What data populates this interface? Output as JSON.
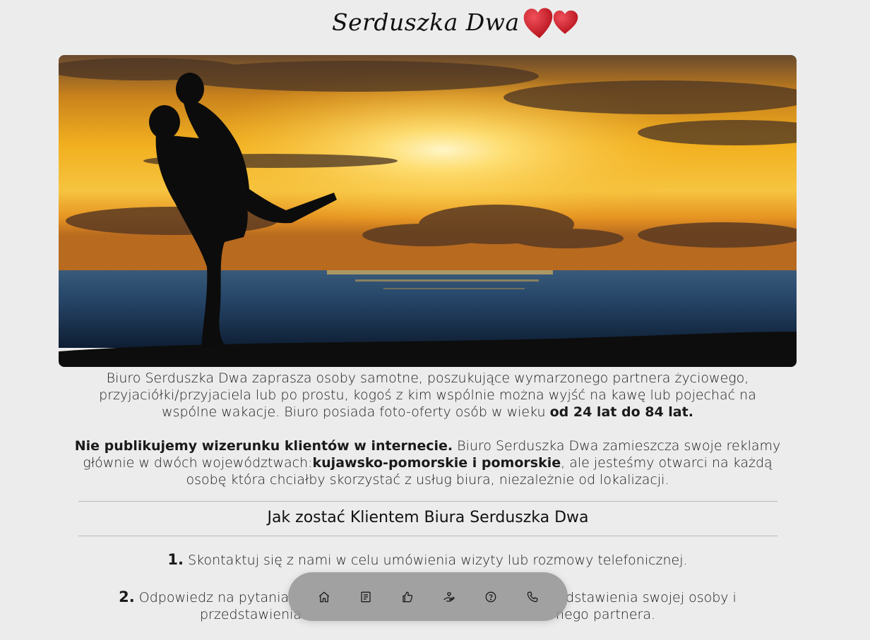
{
  "header": {
    "logo_text": "Serduszka Dwa"
  },
  "hero": {
    "image": "couple-silhouette-sunset-beach"
  },
  "intro": {
    "p1_text": "Biuro Serduszka Dwa zaprasza osoby samotne, poszukujące wymarzonego partnera życiowego, przyjaciółki/przyjaciela lub po prostu, kogoś z kim wspólnie można wyjść na kawę lub pojechać na wspólne wakacje. Biuro posiada foto-oferty osób w wieku ",
    "p1_bold": "od 24 lat do 84 lat.",
    "p2_bold": "Nie publikujemy wizerunku klientów w internecie.",
    "p2_text_a": " Biuro Serduszka Dwa zamieszcza swoje reklamy głównie w dwóch województwach:",
    "p2_bold_regions": "kujawsko-pomorskie i pomorskie",
    "p2_text_b": ", ale jesteśmy otwarci na każdą osobę która chciałby skorzystać z usług biura, niezależnie od lokalizacji."
  },
  "section": {
    "title": "Jak zostać Klientem Biura Serduszka Dwa"
  },
  "steps": [
    {
      "num": "1.",
      "text": "Skontaktuj się z nami w celu umówienia wizyty lub rozmowy telefonicznej."
    },
    {
      "num": "2.",
      "text_a": "Odpowiedz na pytania",
      "text_b": "dstawienia swojej osoby i",
      "text_c": "przedstawienia",
      "text_d": "nego partnera."
    }
  ],
  "nav": {
    "icons": [
      "home-icon",
      "document-icon",
      "thumbs-up-icon",
      "hand-heart-icon",
      "help-icon",
      "phone-icon"
    ]
  },
  "colors": {
    "background": "#ececec",
    "heart_red": "#d61f2b",
    "nav_bg": "#969696"
  }
}
